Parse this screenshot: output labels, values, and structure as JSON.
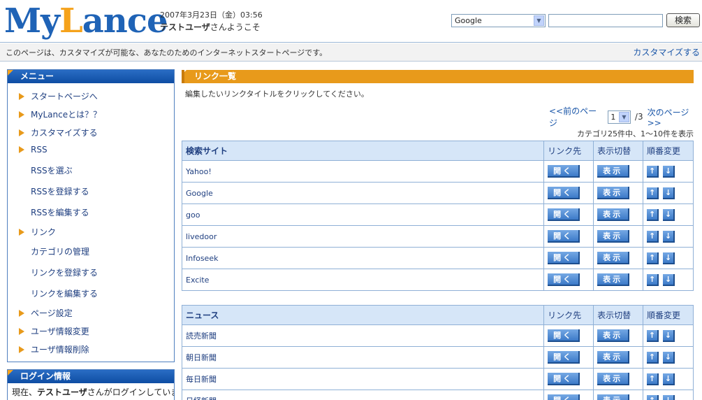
{
  "header": {
    "logo_part1": "My",
    "logo_part2": "L",
    "logo_part3": "ance",
    "date": "2007年3月23日（金）03:56",
    "user": "テストユーザ",
    "welcome_suffix": "さんようこそ",
    "search_engine": "Google",
    "search_button": "検索"
  },
  "infobar": {
    "message": "このページは、カスタマイズが可能な、あなたのためのインターネットスタートページです。",
    "customize_link": "カスタマイズする"
  },
  "sidebar": {
    "menu_title": "メニュー",
    "items": [
      {
        "label": "スタートページへ",
        "type": "main"
      },
      {
        "label": "MyLanceとは？？",
        "type": "main"
      },
      {
        "label": "カスタマイズする",
        "type": "main"
      },
      {
        "label": "RSS",
        "type": "main"
      },
      {
        "label": "RSSを選ぶ",
        "type": "sub"
      },
      {
        "label": "RSSを登録する",
        "type": "sub"
      },
      {
        "label": "RSSを編集する",
        "type": "sub"
      },
      {
        "label": "リンク",
        "type": "main"
      },
      {
        "label": "カテゴリの管理",
        "type": "sub"
      },
      {
        "label": "リンクを登録する",
        "type": "sub"
      },
      {
        "label": "リンクを編集する",
        "type": "sub"
      },
      {
        "label": "ページ設定",
        "type": "main"
      },
      {
        "label": "ユーザ情報変更",
        "type": "main"
      },
      {
        "label": "ユーザ情報削除",
        "type": "main"
      }
    ],
    "login_title": "ログイン情報",
    "login_prefix": "現在、",
    "login_user": "テストユーザ",
    "login_suffix": "さんがログインしていま"
  },
  "main": {
    "title": "リンク一覧",
    "instruction": "編集したいリンクタイトルをクリックしてください。",
    "prev_page": "<<前のページ",
    "page_value": "1",
    "page_total": "/3",
    "next_page": "次のページ>>",
    "count_text": "カテゴリ25件中、1〜10件を表示",
    "col_link": "リンク先",
    "col_toggle": "表示切替",
    "col_order": "順番変更",
    "open_label": "開く",
    "show_label": "表示",
    "up_arrow": "↑",
    "down_arrow": "↓",
    "tables": [
      {
        "category": "検索サイト",
        "rows": [
          "Yahoo!",
          "Google",
          "goo",
          "livedoor",
          "Infoseek",
          "Excite"
        ]
      },
      {
        "category": "ニュース",
        "rows": [
          "読売新聞",
          "朝日新聞",
          "毎日新聞",
          "日経新聞"
        ]
      }
    ]
  }
}
